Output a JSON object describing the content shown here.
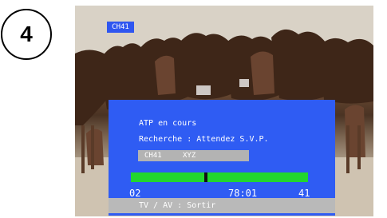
{
  "step_number": "4",
  "screen": {
    "channel_badge": "CH41",
    "background_image": "herd of horses running",
    "osd": {
      "title": "ATP en cours",
      "status": "Recherche : Attendez S.V.P.",
      "channel_code": "CH41",
      "channel_name": "XYZ",
      "progress": {
        "fraction": 0.425,
        "start_label": "02",
        "current_label": "78:01",
        "end_label": "41",
        "fill_color": "#22d62e"
      },
      "footer_hint": "TV / AV : Sortir",
      "panel_color": "#2f5cf3"
    }
  }
}
